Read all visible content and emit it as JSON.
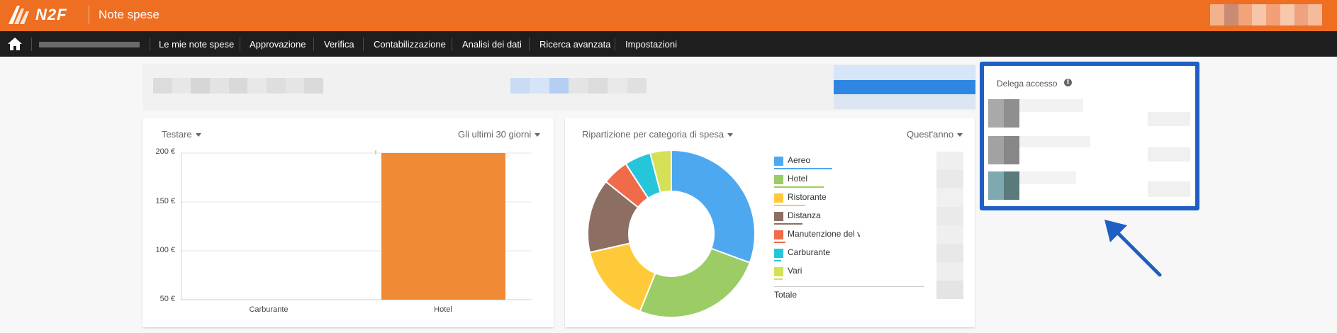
{
  "header": {
    "logo_text": "N2F",
    "app_title": "Note spese",
    "brand_color": "#ee6e22"
  },
  "nav": {
    "items": [
      {
        "label": "Le mie note spese"
      },
      {
        "label": "Approvazione"
      },
      {
        "label": "Verifica"
      },
      {
        "label": "Contabilizzazione"
      },
      {
        "label": "Analisi dei dati"
      },
      {
        "label": "Ricerca avanzata"
      },
      {
        "label": "Impostazioni"
      }
    ],
    "home_icon": "home-icon"
  },
  "bar_card": {
    "filter_label": "Testare",
    "period_label": "Gli ultimi 30 giorni"
  },
  "donut_card": {
    "filter_label": "Ripartizione per categoria di spesa",
    "period_label": "Quest'anno",
    "legend": [
      {
        "label": "Aereo",
        "color": "#4ea8f0"
      },
      {
        "label": "Hotel",
        "color": "#9ccc65"
      },
      {
        "label": "Ristorante",
        "color": "#ffca3a"
      },
      {
        "label": "Distanza",
        "color": "#8d6e63"
      },
      {
        "label": "Manutenzione del v",
        "color": "#f06b4a"
      },
      {
        "label": "Carburante",
        "color": "#26c6da"
      },
      {
        "label": "Vari",
        "color": "#d4e157"
      }
    ],
    "total_label": "Totale"
  },
  "delega": {
    "title": "Delega accesso",
    "info_icon": "i"
  },
  "chart_data": [
    {
      "type": "bar",
      "categories": [
        "Carburante",
        "Hotel"
      ],
      "values": [
        0,
        200
      ],
      "y_ticks": [
        "50 €",
        "100 €",
        "150 €",
        "200 €"
      ],
      "ylim": [
        50,
        200
      ],
      "grid": true,
      "bar_color": "#f08a35"
    },
    {
      "type": "pie",
      "categories": [
        "Aereo",
        "Hotel",
        "Ristorante",
        "Distanza",
        "Manutenzione del v",
        "Carburante",
        "Vari"
      ],
      "values": [
        30,
        25,
        15,
        14,
        5,
        5,
        4
      ],
      "colors": [
        "#4ea8f0",
        "#9ccc65",
        "#ffca3a",
        "#8d6e63",
        "#f06b4a",
        "#26c6da",
        "#d4e157"
      ],
      "donut": true
    }
  ]
}
